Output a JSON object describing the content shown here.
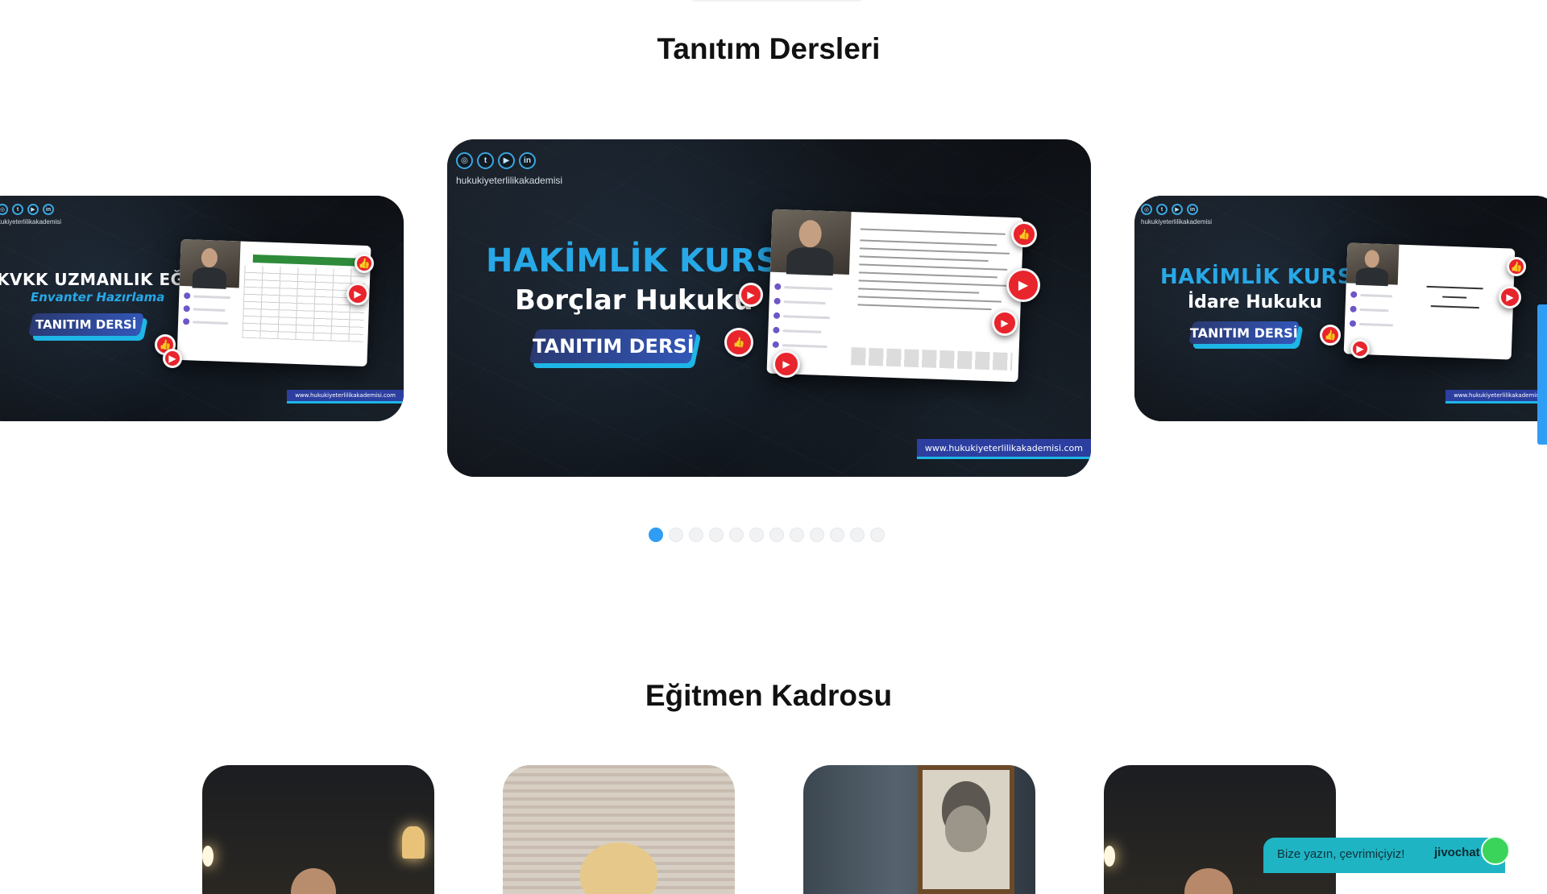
{
  "sections": {
    "intro_title": "Tanıtım Dersleri",
    "instructors_title": "Eğitmen Kadrosu"
  },
  "slides": [
    {
      "handle": "hukukiyeterlilikakademisi",
      "title": "KVKK UZMANLIK EĞİTİMİ",
      "subtitle": "Envanter Hazırlama",
      "badge": "TANITIM DERSİ",
      "url": "www.hukukiyeterlilikakademisi.com"
    },
    {
      "handle": "hukukiyeterlilikakademisi",
      "title": "HAKİMLİK KURSU",
      "subtitle": "Borçlar Hukuku",
      "badge": "TANITIM DERSİ",
      "url": "www.hukukiyeterlilikakademisi.com"
    },
    {
      "handle": "hukukiyeterlilikakademisi",
      "title": "HAKİMLİK KURSU",
      "subtitle": "İdare Hukuku",
      "badge": "TANITIM DERSİ",
      "url": "www.hukukiyeterlilikakademisi.com"
    }
  ],
  "pagination": {
    "total": 12,
    "active": 1
  },
  "jivochat": {
    "message": "Bize yazın, çevrimiçiyiz!",
    "brand": "jivochat"
  },
  "colors": {
    "accent": "#2f9df4",
    "title_blue": "#27a9e8",
    "badge_blue": "#3256b8",
    "bubble_red": "#e8242c",
    "chat_teal": "#1fb4c4",
    "online_green": "#3bd45b"
  },
  "icons": [
    "instagram-icon",
    "twitter-icon",
    "youtube-icon",
    "linkedin-icon",
    "like-icon",
    "play-icon"
  ]
}
